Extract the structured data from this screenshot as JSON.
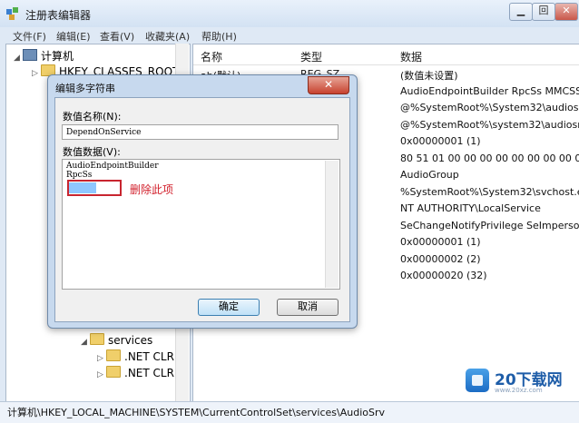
{
  "window": {
    "title": "注册表编辑器",
    "min_label": "□",
    "max_label": "回",
    "close_label": "✕"
  },
  "menu": [
    "文件(F)",
    "编辑(E)",
    "查看(V)",
    "收藏夹(A)",
    "帮助(H)"
  ],
  "tree": {
    "root": "计算机",
    "items": [
      "HKEY_CLASSES_ROOT",
      "services",
      ".NET CLR",
      ".NET CLR"
    ]
  },
  "list": {
    "headers": {
      "name": "名称",
      "type": "类型",
      "data": "数据"
    },
    "rows": [
      {
        "name": "ab(默认)",
        "type": "REG_SZ",
        "data": "(数值未设置)"
      },
      {
        "name": "",
        "type": "M_SZ",
        "data": "AudioEndpointBuilder RpcSs MMCSS"
      },
      {
        "name": "",
        "type": "",
        "data": "@%SystemRoot%\\System32\\audiosrv"
      },
      {
        "name": "",
        "type": "",
        "data": "@%SystemRoot%\\system32\\audiosrv"
      },
      {
        "name": "",
        "type": "RD",
        "data": "0x00000001 (1)"
      },
      {
        "name": "",
        "type": "RY",
        "data": "80 51 01 00 00 00 00 00 00 00 00 00"
      },
      {
        "name": "",
        "type": "",
        "data": "AudioGroup"
      },
      {
        "name": "",
        "type": "ND_SZ",
        "data": "%SystemRoot%\\System32\\svchost.exe"
      },
      {
        "name": "",
        "type": "",
        "data": "NT AUTHORITY\\LocalService"
      },
      {
        "name": "",
        "type": "M_SZ",
        "data": "SeChangeNotifyPrivilege SeImperson"
      },
      {
        "name": "",
        "type": "RD",
        "data": "0x00000001 (1)"
      },
      {
        "name": "",
        "type": "RD",
        "data": "0x00000002 (2)"
      },
      {
        "name": "",
        "type": "RD",
        "data": "0x00000020 (32)"
      }
    ]
  },
  "status": "计算机\\HKEY_LOCAL_MACHINE\\SYSTEM\\CurrentControlSet\\services\\AudioSrv",
  "dialog": {
    "title": "编辑多字符串",
    "close_label": "✕",
    "name_label": "数值名称(N):",
    "name_value": "DependOnService",
    "data_label": "数值数据(V):",
    "data_lines": [
      "AudioEndpointBuilder",
      "RpcSs"
    ],
    "annotation": "删除此项",
    "ok": "确定",
    "cancel": "取消"
  },
  "watermark": {
    "text": "20下载网",
    "sub": "www.20xz.com"
  }
}
